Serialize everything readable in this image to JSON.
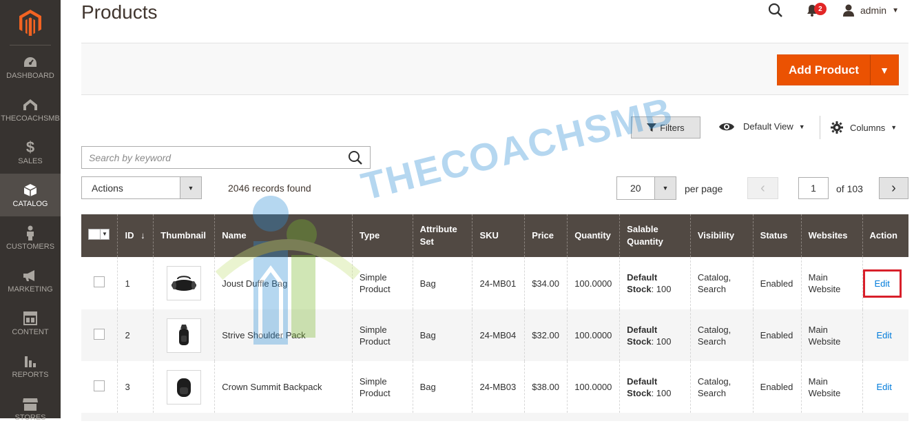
{
  "sidebar": {
    "items": [
      {
        "label": "DASHBOARD",
        "icon": "dashboard-icon"
      },
      {
        "label": "THECOACHSMB",
        "icon": "thecoachsmb-icon"
      },
      {
        "label": "SALES",
        "icon": "dollar-icon"
      },
      {
        "label": "CATALOG",
        "icon": "box-icon",
        "active": true
      },
      {
        "label": "CUSTOMERS",
        "icon": "person-icon"
      },
      {
        "label": "MARKETING",
        "icon": "megaphone-icon"
      },
      {
        "label": "CONTENT",
        "icon": "layout-icon"
      },
      {
        "label": "REPORTS",
        "icon": "bar-chart-icon"
      },
      {
        "label": "STORES",
        "icon": "store-icon"
      }
    ]
  },
  "header": {
    "title": "Products",
    "notifications_count": "2",
    "user": "admin"
  },
  "actions": {
    "add_product": "Add Product"
  },
  "toolbar": {
    "filters": "Filters",
    "default_view": "Default View",
    "columns": "Columns",
    "search_placeholder": "Search by keyword",
    "actions": "Actions",
    "records_found": "2046 records found",
    "per_page_value": "20",
    "per_page_label": "per page",
    "page_value": "1",
    "of_pages": "of 103"
  },
  "watermark": "THECOACHSMB",
  "table": {
    "headers": [
      "ID",
      "Thumbnail",
      "Name",
      "Type",
      "Attribute Set",
      "SKU",
      "Price",
      "Quantity",
      "Salable Quantity",
      "Visibility",
      "Status",
      "Websites",
      "Action"
    ],
    "rows": [
      {
        "id": "1",
        "name": "Joust Duffle Bag",
        "type": "Simple Product",
        "attribute_set": "Bag",
        "sku": "24-MB01",
        "price": "$34.00",
        "quantity": "100.0000",
        "salable_bold": "Default Stock",
        "salable_rest": ": 100",
        "visibility": "Catalog, Search",
        "status": "Enabled",
        "websites": "Main Website",
        "action": "Edit"
      },
      {
        "id": "2",
        "name": "Strive Shoulder Pack",
        "type": "Simple Product",
        "attribute_set": "Bag",
        "sku": "24-MB04",
        "price": "$32.00",
        "quantity": "100.0000",
        "salable_bold": "Default Stock",
        "salable_rest": ": 100",
        "visibility": "Catalog, Search",
        "status": "Enabled",
        "websites": "Main Website",
        "action": "Edit"
      },
      {
        "id": "3",
        "name": "Crown Summit Backpack",
        "type": "Simple Product",
        "attribute_set": "Bag",
        "sku": "24-MB03",
        "price": "$38.00",
        "quantity": "100.0000",
        "salable_bold": "Default Stock",
        "salable_rest": ": 100",
        "visibility": "Catalog, Search",
        "status": "Enabled",
        "websites": "Main Website",
        "action": "Edit"
      }
    ]
  },
  "colors": {
    "accent": "#eb5202",
    "sidebar": "#373330",
    "table_header": "#514943",
    "link": "#007bdb",
    "highlight": "#d81f2a"
  }
}
